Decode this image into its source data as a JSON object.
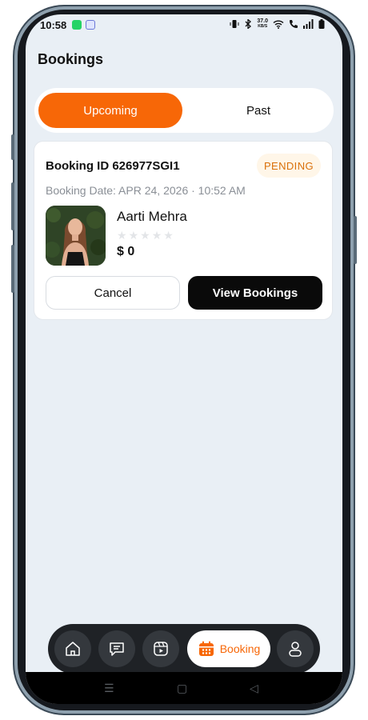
{
  "status_bar": {
    "time": "10:58",
    "net_speed_value": "37.0",
    "net_speed_unit": "KB/S"
  },
  "page": {
    "title": "Bookings"
  },
  "tabs": [
    {
      "label": "Upcoming",
      "active": true
    },
    {
      "label": "Past",
      "active": false
    }
  ],
  "booking": {
    "id_text": "Booking ID 626977SGI1",
    "status": "PENDING",
    "date_text": "Booking Date: APR 24, 2026 · 10:52 AM",
    "name": "Aarti Mehra",
    "rating": 0,
    "rating_max": 5,
    "price": "$ 0",
    "cancel_label": "Cancel",
    "view_label": "View Bookings"
  },
  "bottom_nav": {
    "items": [
      {
        "icon": "home-icon"
      },
      {
        "icon": "chat-icon"
      },
      {
        "icon": "reels-icon"
      },
      {
        "icon": "calendar-icon",
        "label": "Booking",
        "active": true
      },
      {
        "icon": "profile-icon"
      }
    ]
  },
  "colors": {
    "accent": "#f76707",
    "background": "#e9eff5",
    "badge_text": "#d9700a",
    "badge_bg": "#fff6e8"
  }
}
